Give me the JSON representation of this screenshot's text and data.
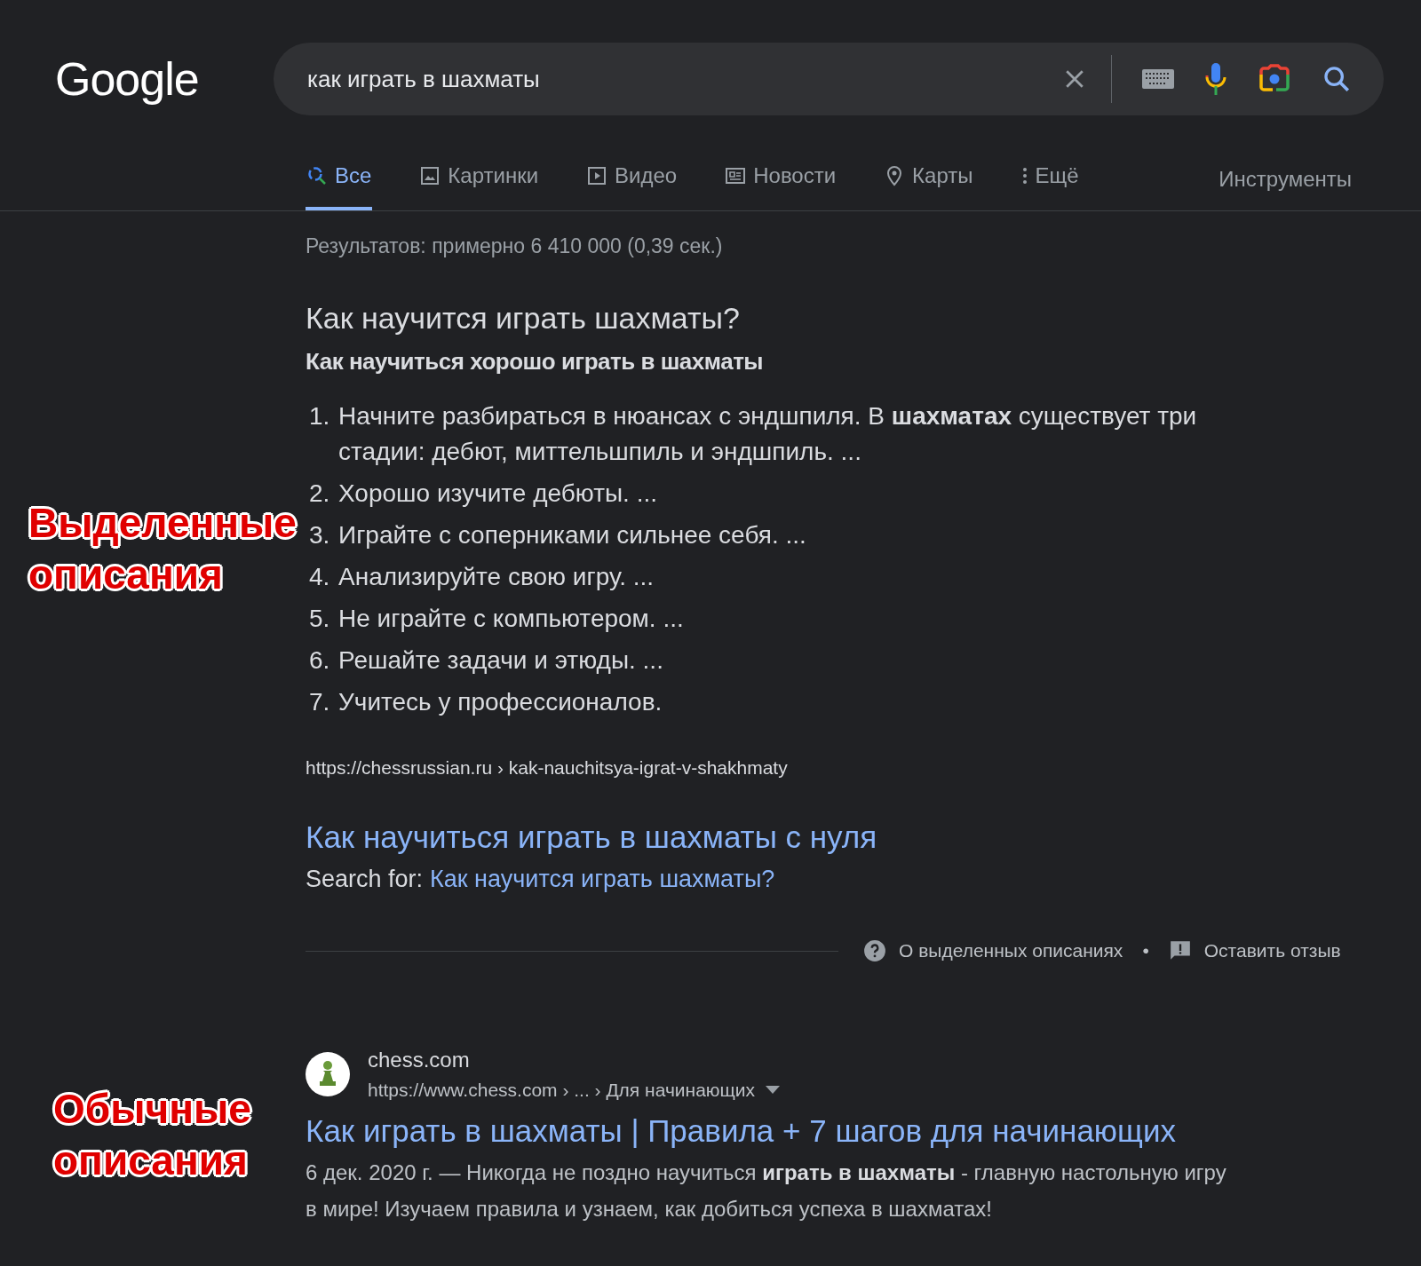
{
  "header": {
    "logo": "Google",
    "search": {
      "value": "как играть в шахматы"
    }
  },
  "tabs": [
    {
      "label": "Все",
      "kind": "all",
      "selected": true
    },
    {
      "label": "Картинки",
      "kind": "images",
      "selected": false
    },
    {
      "label": "Видео",
      "kind": "video",
      "selected": false
    },
    {
      "label": "Новости",
      "kind": "news",
      "selected": false
    },
    {
      "label": "Карты",
      "kind": "maps",
      "selected": false
    },
    {
      "label": "Ещё",
      "kind": "more",
      "selected": false
    }
  ],
  "tools": "Инструменты",
  "result_stats": "Результатов: примерно 6 410 000 (0,39 сек.)",
  "featured_snippet": {
    "question": "Как научится играть шахматы?",
    "heading": "Как научиться хорошо играть в шахматы",
    "steps": [
      {
        "number": "1.",
        "text": "Начните разбираться в нюансах с эндшпиля. В **шахматах** существует три стадии: дебют, миттельшпиль и эндшпиль. ..."
      },
      {
        "number": "2.",
        "text": "Хорошо изучите дебюты. ..."
      },
      {
        "number": "3.",
        "text": "Играйте с соперниками сильнее себя. ..."
      },
      {
        "number": "4.",
        "text": "Анализируйте свою игру. ..."
      },
      {
        "number": "5.",
        "text": "Не играйте с компьютером. ..."
      },
      {
        "number": "6.",
        "text": "Решайте задачи и этюды. ..."
      },
      {
        "number": "7.",
        "text": "Учитесь у профессионалов."
      }
    ],
    "url": "https://chessrussian.ru › kak-nauchitsya-igrat-v-shakhmaty",
    "title": "Как научиться играть в шахматы с нуля",
    "search_for_label": "Search for:",
    "search_for_link": "Как научится играть шахматы?",
    "about": "О выделенных описаниях",
    "separator": "•",
    "feedback": "Оставить отзыв"
  },
  "result": {
    "site": "chess.com",
    "breadcrumb": "https://www.chess.com › ... › Для начинающих",
    "title": "Как играть в шахматы | Правила + 7 шагов для начинающих",
    "snippet": "6 дек. 2020 г. — Никогда не поздно научиться **играть в шахматы** - главную настольную игру в мире! Изучаем правила и узнаем, как добиться успеха в шахматах!"
  },
  "annotations": [
    {
      "lines": [
        "Выделенные",
        "описания"
      ]
    },
    {
      "lines": [
        "Обычные",
        "описания"
      ]
    }
  ]
}
